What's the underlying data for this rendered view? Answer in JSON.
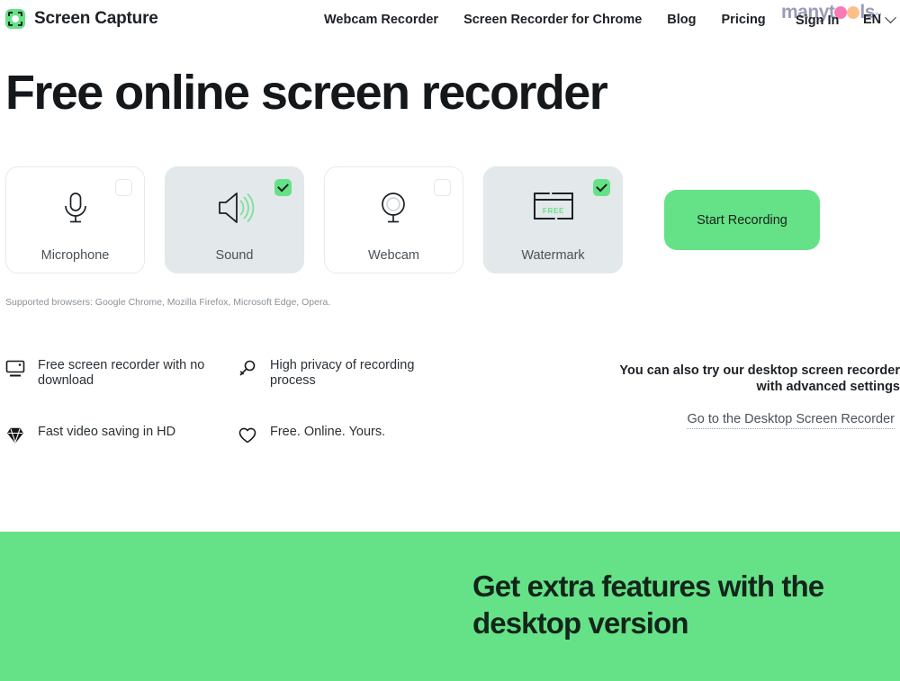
{
  "header": {
    "brand": {
      "name": "Screen Capture",
      "logo_icon": "screen-capture-logo-icon"
    },
    "nav": [
      {
        "label": "Webcam Recorder"
      },
      {
        "label": "Screen Recorder for Chrome"
      },
      {
        "label": "Blog"
      },
      {
        "label": "Pricing"
      }
    ],
    "sign_in": "Sign In",
    "language": "EN",
    "language_chevron_icon": "chevron-down-icon",
    "manytools": {
      "part1": "manyt",
      "part2": "ls",
      "trademark": "™",
      "circle1_color": "#f57ab6",
      "circle2_color": "#fbc08a"
    }
  },
  "hero": {
    "title": "Free online screen recorder",
    "options": [
      {
        "label": "Microphone",
        "checked": false,
        "icon": "microphone-icon"
      },
      {
        "label": "Sound",
        "checked": true,
        "icon": "speaker-icon"
      },
      {
        "label": "Webcam",
        "checked": false,
        "icon": "webcam-icon"
      },
      {
        "label": "Watermark",
        "checked": true,
        "icon": "watermark-icon",
        "badge_text": "FREE"
      }
    ],
    "start_button": "Start Recording",
    "supported_browsers": "Supported browsers: Google Chrome, Mozilla Firefox, Microsoft Edge, Opera."
  },
  "features": [
    {
      "text": "Free screen recorder with no download",
      "icon": "monitor-icon"
    },
    {
      "text": "High privacy of recording process",
      "icon": "keyhole-icon"
    },
    {
      "text": "Fast video saving in HD",
      "icon": "diamond-icon"
    },
    {
      "text": "Free. Online. Yours.",
      "icon": "heart-icon"
    }
  ],
  "promo": {
    "line1": "You can also try our desktop screen recorder",
    "line2": "with advanced settings",
    "link": "Go to the Desktop Screen Recorder"
  },
  "band": {
    "title_line1": "Get extra features with the",
    "title_line2": "desktop version"
  },
  "colors": {
    "accent_green": "#65e287",
    "card_active_bg": "#e3e8ea",
    "text_dark": "#1d2125"
  }
}
